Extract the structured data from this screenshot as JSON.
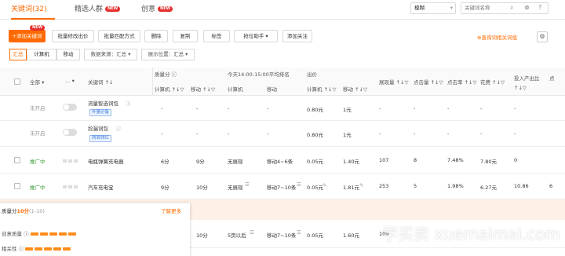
{
  "tabs": [
    {
      "label": "关键词",
      "count": "(32)"
    },
    {
      "label": "精选人群",
      "badge": "NEW"
    },
    {
      "label": "创意",
      "badge": "NEW"
    }
  ],
  "search": {
    "mode": "模糊",
    "placeholder": "关键词名称"
  },
  "toolbar": {
    "add_keyword": "+添加关键词",
    "add_keyword_badge": "NEW",
    "batch_bid": "批量修改出价",
    "batch_match": "批量匹配方式",
    "delete": "删除",
    "copy": "复制",
    "tag": "标签",
    "rank_assist": "抢位助手",
    "add_follow": "添加关注",
    "query_link": "查询词相关词组"
  },
  "filters": {
    "segments": [
      "汇总",
      "计算机",
      "移动"
    ],
    "source": "数据来源：汇总",
    "position": "展示位置：汇总"
  },
  "columns": {
    "all": "全部",
    "keyword": "关键词",
    "quality": "质量分",
    "rank_group": "今天14:00-15:00平均排名",
    "bid": "出价",
    "pc": "计算机",
    "mobile": "移动",
    "impressions": "展现量",
    "clicks": "点击量",
    "ctr": "点击率",
    "cost": "花费",
    "roi": "投入产出比",
    "more": "点"
  },
  "rows": [
    {
      "status": "未开启",
      "keyword": "流量智选词包",
      "tag": "补量必备",
      "q_pc": "-",
      "q_mob": "-",
      "r_pc": "-",
      "r_mob": "-",
      "bid_pc": "0.80元",
      "bid_mob": "1元",
      "imp": "-",
      "clk": "-",
      "ctr": "-",
      "cost": "-",
      "roi": "-"
    },
    {
      "status": "未开启",
      "keyword": "捡漏词包",
      "tag": "两周领红",
      "q_pc": "-",
      "q_mob": "-",
      "r_pc": "-",
      "r_mob": "-",
      "bid_pc": "0.80元",
      "bid_mob": "1元",
      "imp": "-",
      "clk": "-",
      "ctr": "-",
      "cost": "-",
      "roi": "-"
    },
    {
      "status": "推广中",
      "keyword": "电瓶弹簧充电器",
      "q_pc": "6分",
      "q_mob": "9分",
      "r_pc": "无展现",
      "r_mob": "移动4~6条",
      "bid_pc": "0.05元",
      "bid_mob": "1.40元",
      "imp": "107",
      "clk": "8",
      "ctr": "7.48%",
      "cost": "7.80元",
      "roi": "0"
    },
    {
      "status": "推广中",
      "keyword": "汽车充电宝",
      "q_pc": "9分",
      "q_mob": "10分",
      "r_pc": "无展现",
      "r_mob": "移动7~10条",
      "bid_pc": "0.05元",
      "bid_mob": "1.81元",
      "imp": "253",
      "clk": "5",
      "ctr": "1.98%",
      "cost": "6.27元",
      "roi": "10.86",
      "extra": "6"
    },
    {
      "q_mob": "10分",
      "r_pc": "5页以后",
      "r_mob": "移动7~10条",
      "bid_pc": "0.05元",
      "bid_mob": "1.60元",
      "imp": "109"
    }
  ],
  "popup": {
    "title_prefix": "质量分",
    "score": "10分",
    "range": "(1-10)",
    "learn_more": "了解更多",
    "items": [
      {
        "label": "创意质量"
      },
      {
        "label": "相关性"
      }
    ]
  },
  "watermark": "学买卖 xuemaimai.com",
  "colors": {
    "accent": "#ff6a00",
    "new_badge": "#e5302d",
    "active_status": "#3a9d3a",
    "tag_blue": "#3a7ce0"
  }
}
